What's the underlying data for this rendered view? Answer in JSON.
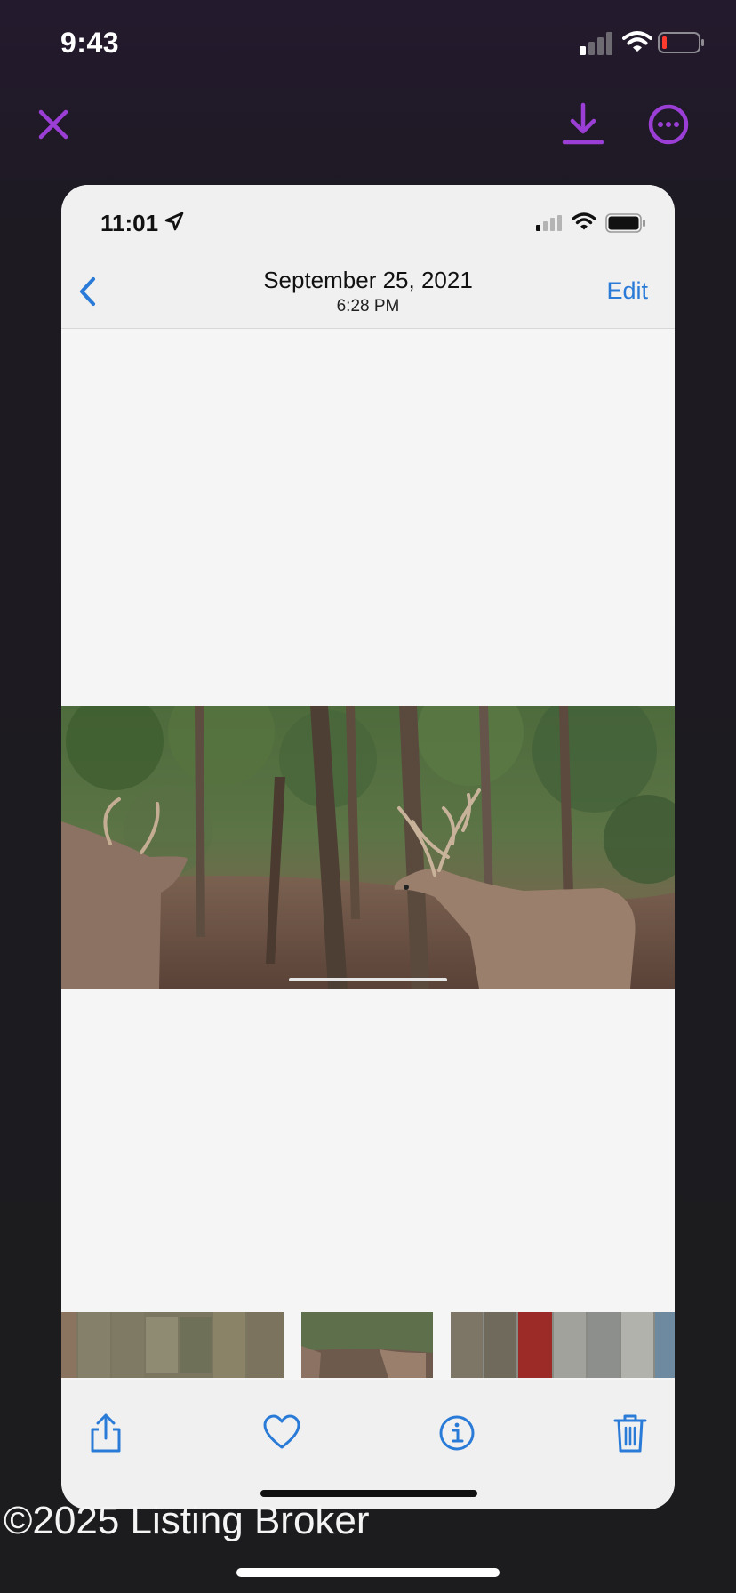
{
  "status_bar": {
    "time": "9:43",
    "icons": [
      "cellular-signal-icon",
      "wifi-icon",
      "battery-low-icon"
    ]
  },
  "viewer": {
    "close_icon": "close-icon",
    "download_icon": "download-icon",
    "more_icon": "more-options-icon",
    "accent_color": "#9b3ed6"
  },
  "screenshot": {
    "status_bar": {
      "time": "11:01",
      "icons": [
        "location-arrow-icon",
        "cellular-signal-icon",
        "wifi-icon",
        "battery-full-icon"
      ]
    },
    "nav": {
      "date": "September 25, 2021",
      "time": "6:28 PM",
      "edit_label": "Edit",
      "back_icon": "chevron-left-icon"
    },
    "photo_subject": "trail-camera-photo",
    "toolbar": {
      "icons": [
        "share-icon",
        "heart-icon",
        "info-icon",
        "trash-icon"
      ],
      "accent_color": "#2a7bd8"
    }
  },
  "watermark": "©2025 Listing Broker"
}
